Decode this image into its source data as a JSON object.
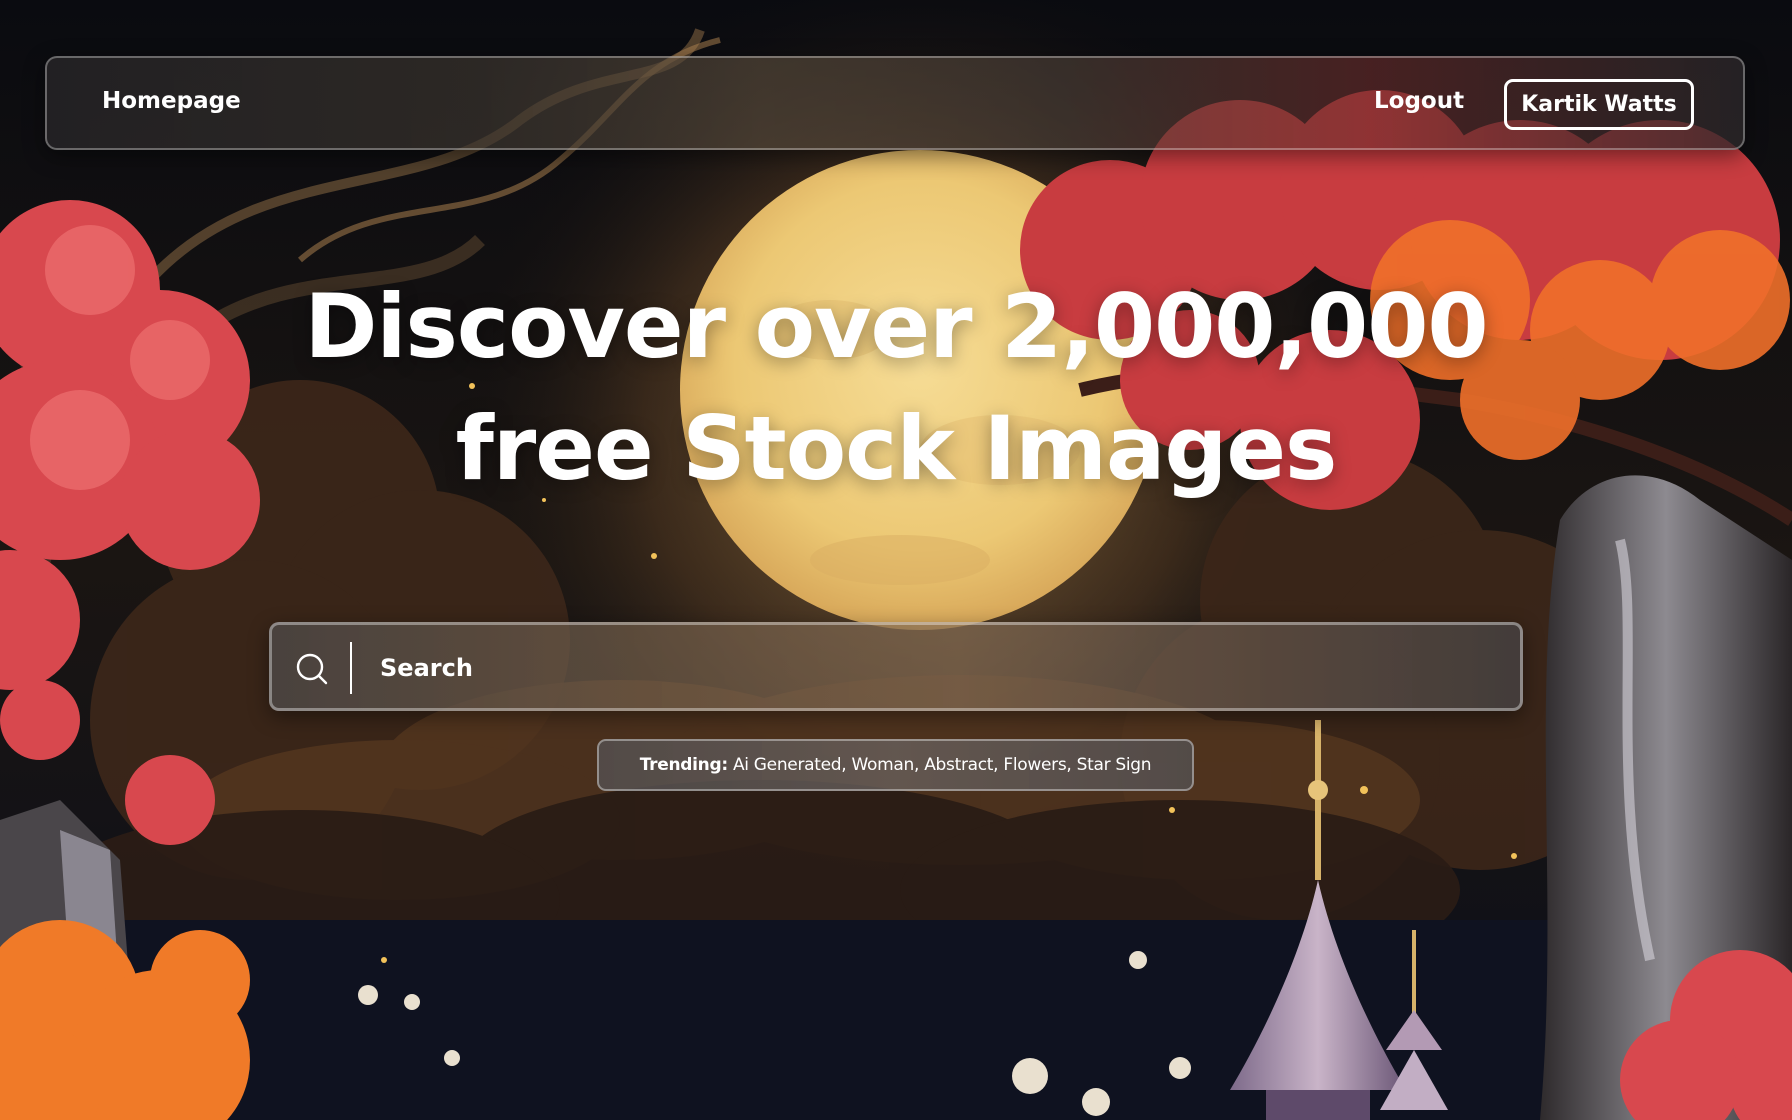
{
  "nav": {
    "home_label": "Homepage",
    "logout_label": "Logout",
    "user_name": "Kartik Watts"
  },
  "hero": {
    "headline_line1": "Discover over 2,000,000",
    "headline_line2": "free Stock Images"
  },
  "search": {
    "placeholder": "Search",
    "value": "",
    "icon": "search-icon"
  },
  "trending": {
    "label": "Trending:",
    "items": [
      "Ai Generated",
      "Woman",
      "Abstract",
      "Flowers",
      "Star Sign"
    ]
  },
  "colors": {
    "text": "#ffffff",
    "sky": "#0d0f18",
    "moon": "#f3d58a",
    "blossom_red": "#d8484e",
    "blossom_orange": "#f07a28",
    "cloud_brown": "#4a3122"
  }
}
